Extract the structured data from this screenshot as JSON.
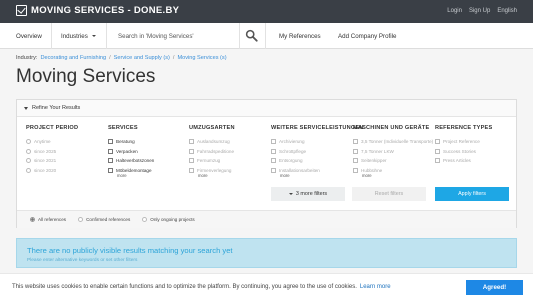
{
  "topbar": {
    "brand": "MOVING SERVICES - DONE.BY",
    "links": [
      "Login",
      "Sign Up",
      "English"
    ]
  },
  "nav": {
    "overview": "Overview",
    "industries": "Industries",
    "search_placeholder": "Search in 'Moving Services'",
    "my_references": "My References",
    "add_company": "Add Company Profile"
  },
  "breadcrumb": {
    "label": "Industry:",
    "items": [
      "Decorating and Furnishing",
      "Service and Supply (s)",
      "Moving Services (s)"
    ]
  },
  "page_title": "Moving Services",
  "filters": {
    "header": "Refine Your Results",
    "columns": [
      {
        "title": "PROJECT PERIOD",
        "type": "radio",
        "options": [
          "Anytime",
          "since 2025",
          "since 2021",
          "since 2020"
        ],
        "more": ""
      },
      {
        "title": "SERVICES",
        "type": "check",
        "options": [
          "Beratung",
          "Verpacken",
          "Halteverbotszonen",
          "Möbeldemontage"
        ],
        "more": "more"
      },
      {
        "title": "UMZUGSARTEN",
        "type": "check",
        "options": [
          "Auslandsumzug",
          "Fahrradspeditione",
          "Fernumzug",
          "Firmenverlegung"
        ],
        "more": "more"
      },
      {
        "title": "WEITERE SERVICELEISTUNGEN",
        "type": "check",
        "options": [
          "Archivierung",
          "Schrottpflege",
          "Entsorgung",
          "Installationsarbeiten"
        ],
        "more": "more"
      },
      {
        "title": "MASCHINEN UND GERÄTE",
        "type": "check",
        "options": [
          "3,5 Tonner (Individuelle Transporte)",
          "7,5 Tonner LKW",
          "Seitenkipper",
          "Hubbühne"
        ],
        "more": "more"
      },
      {
        "title": "REFERENCE TYPES",
        "type": "check",
        "options": [
          "Project Reference",
          "Success Stories",
          "Press Articles"
        ],
        "more": ""
      }
    ],
    "more_filters_label": "3 more filters",
    "reset_label": "Reset filters",
    "apply_label": "Apply filters",
    "footer_options": [
      "All references",
      "Confirmed references",
      "Only ongoing projects"
    ],
    "footer_selected": 0
  },
  "notice": {
    "title": "There are no publicly visible results matching your search yet",
    "subtitle": "Please enter alternative keywords or set other filters"
  },
  "cookie": {
    "text": "This website uses cookies to enable certain functions and to optimize the platform. By continuing, you agree to the use of cookies.",
    "learn_more": "Learn more",
    "accept": "Agreed!"
  },
  "colors": {
    "topbar": "#3a3f46",
    "accent": "#1ea7e5",
    "notice_bg": "#bfe3f0",
    "cookie_button": "#1e88e5"
  }
}
